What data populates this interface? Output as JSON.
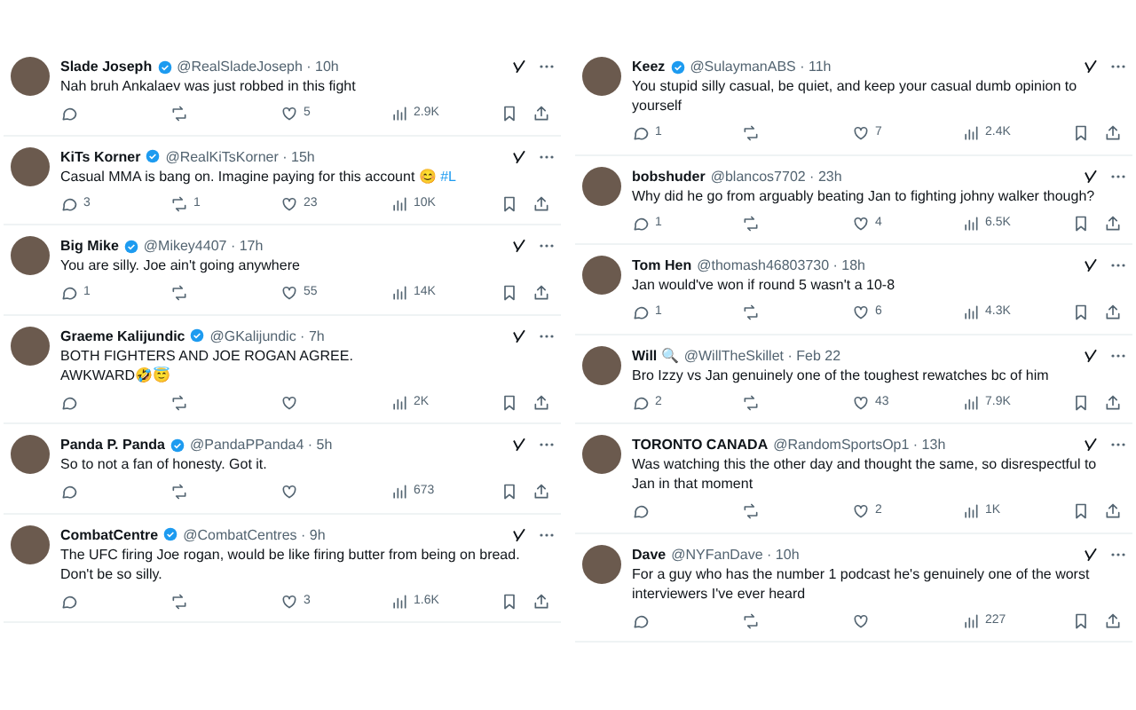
{
  "columns": [
    {
      "tweets": [
        {
          "name": "Slade Joseph",
          "verified": true,
          "meta": "@RealSladeJoseph · 10h",
          "text": "Nah bruh Ankalaev was just robbed in this fight",
          "likes": "5",
          "views": "2.9K"
        },
        {
          "name": "KiTs Korner",
          "verified": true,
          "meta": "@RealKiTsKorner · 15h",
          "text": "Casual MMA is bang on. Imagine paying for this account 😊 ",
          "hashtag": "#L",
          "replies": "3",
          "retweets": "1",
          "likes": "23",
          "views": "10K"
        },
        {
          "name": "Big Mike",
          "verified": true,
          "meta": "@Mikey4407 · 17h",
          "text": "You are silly. Joe ain't going anywhere",
          "replies": "1",
          "likes": "55",
          "views": "14K"
        },
        {
          "name": "Graeme Kalijundic",
          "verified": true,
          "meta": "@GKalijundic · 7h",
          "text": "BOTH FIGHTERS AND JOE ROGAN AGREE.\nAWKWARD🤣😇",
          "views": "2K"
        },
        {
          "name": "Panda P. Panda",
          "verified": true,
          "meta": "@PandaPPanda4 · 5h",
          "text": "So to not a fan of honesty. Got it.",
          "views": "673"
        },
        {
          "name": "CombatCentre",
          "verified": true,
          "meta": "@CombatCentres · 9h",
          "text": "The UFC firing Joe rogan, would be like firing butter from being on bread. Don't be so silly.",
          "likes": "3",
          "views": "1.6K"
        }
      ]
    },
    {
      "tweets": [
        {
          "name": "Keez",
          "verified": true,
          "meta": "@SulaymanABS · 11h",
          "text": "You stupid silly casual, be quiet, and keep your casual dumb opinion to yourself",
          "replies": "1",
          "likes": "7",
          "views": "2.4K"
        },
        {
          "name": "bobshuder",
          "verified": false,
          "meta": "@blancos7702 · 23h",
          "text": "Why did he go from arguably beating  Jan to fighting johny walker though?",
          "replies": "1",
          "likes": "4",
          "views": "6.5K"
        },
        {
          "name": "Tom Hen",
          "verified": false,
          "meta": "@thomash46803730 · 18h",
          "text": "Jan would've won if round 5 wasn't a 10-8",
          "replies": "1",
          "likes": "6",
          "views": "4.3K"
        },
        {
          "name": "Will 🔍",
          "verified": false,
          "meta": "@WillTheSkillet · Feb 22",
          "text": "Bro Izzy vs Jan genuinely one of the toughest rewatches bc of him",
          "replies": "2",
          "likes": "43",
          "views": "7.9K"
        },
        {
          "name": "TORONTO CANADA",
          "verified": false,
          "meta": "@RandomSportsOp1 · 13h",
          "text": "Was watching this the other day and thought the same, so disrespectful to Jan in that moment",
          "likes": "2",
          "views": "1K"
        },
        {
          "name": "Dave",
          "verified": false,
          "meta": "@NYFanDave · 10h",
          "text": "For a guy who has the number 1 podcast he's genuinely one of the worst interviewers I've ever heard",
          "views": "227"
        }
      ]
    }
  ]
}
